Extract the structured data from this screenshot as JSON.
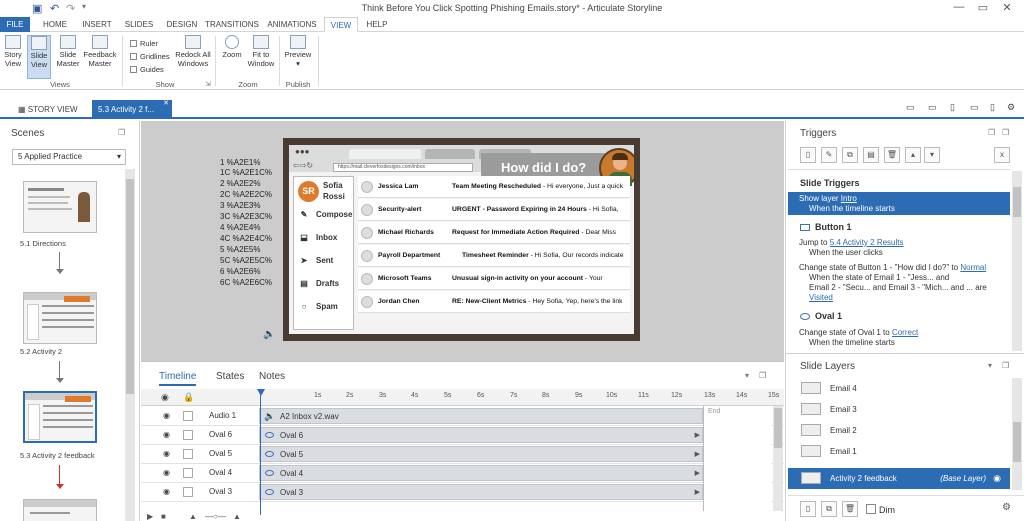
{
  "window": {
    "title": "Think Before You Click Spotting Phishing Emails.story* - Articulate Storyline",
    "minimize": "—",
    "restore": "▭",
    "close": "✕"
  },
  "menu_tabs": [
    "FILE",
    "HOME",
    "INSERT",
    "SLIDES",
    "DESIGN",
    "TRANSITIONS",
    "ANIMATIONS",
    "VIEW",
    "HELP"
  ],
  "ribbon": {
    "views": {
      "story_view": [
        "Story",
        "View"
      ],
      "slide_view": [
        "Slide",
        "View"
      ],
      "slide_master": [
        "Slide",
        "Master"
      ],
      "feedback_master": [
        "Feedback",
        "Master"
      ],
      "group": "Views"
    },
    "show": {
      "ruler": "Ruler",
      "gridlines": "Gridlines",
      "guides": "Guides",
      "redock": [
        "Redock All",
        "Windows"
      ],
      "group": "Show"
    },
    "zoom": {
      "zoom": "Zoom",
      "fit": [
        "Fit to",
        "Window"
      ],
      "group": "Zoom"
    },
    "publish": {
      "preview": "Preview",
      "group": "Publish"
    }
  },
  "doc_tabs": {
    "story": "STORY VIEW",
    "current": "5.3 Activity 2 f..."
  },
  "scenes": {
    "title": "Scenes",
    "selected_scene": "5 Applied Practice",
    "slides": [
      {
        "caption": "5.1 Directions"
      },
      {
        "caption": "5.2 Activity 2"
      },
      {
        "caption": "5.3 Activity 2 feedback"
      }
    ]
  },
  "stage": {
    "variables": [
      "1 %A2E1%",
      "1C %A2E1C%",
      "2 %A2E2%",
      "2C %A2E2C%",
      "3 %A2E3%",
      "3C %A2E3C%",
      "4 %A2E4%",
      "4C %A2E4C%",
      "5 %A2E5%",
      "5C %A2E5C%",
      "6 %A2E6%",
      "6C %A2E6C%"
    ],
    "slide": {
      "url": "https://mail.cleverfoxdesigns.com/inbox",
      "heading": "How did I do?",
      "user_initials": "SR",
      "user_first": "Sofia",
      "user_last": "Rossi",
      "nav": [
        "Compose",
        "Inbox",
        "Sent",
        "Drafts",
        "Spam"
      ],
      "emails": [
        {
          "from": "Jessica Lam",
          "subject": "Team Meeting Rescheduled",
          "preview": " - Hi everyone, Just a quick"
        },
        {
          "from": "Security-alert",
          "subject": "URGENT - Password Expiring in 24 Hours",
          "preview": " - Hi Sofia,"
        },
        {
          "from": "Michael Richards",
          "subject": "Request for Immediate Action Required",
          "preview": " - Dear Miss"
        },
        {
          "from": "Payroll Department",
          "subject": "Timesheet Reminder",
          "preview": " - Hi Sofia, Our records indicate"
        },
        {
          "from": "Microsoft Teams",
          "subject": "Unusual sign-in activity on your account",
          "preview": " - Your"
        },
        {
          "from": "Jordan Chen",
          "subject": "RE: New-Client Metrics",
          "preview": " - Hey Sofia, Yep, here's the link"
        }
      ]
    }
  },
  "timeline": {
    "tabs": [
      "Timeline",
      "States",
      "Notes"
    ],
    "ticks": [
      "1s",
      "2s",
      "3s",
      "4s",
      "5s",
      "6s",
      "7s",
      "8s",
      "9s",
      "10s",
      "11s",
      "12s",
      "13s",
      "14s",
      "15s",
      "1€"
    ],
    "end_label": "End",
    "rows": [
      {
        "name": "Audio 1",
        "bar": "A2 Inbox v2.wav",
        "kind": "audio"
      },
      {
        "name": "Oval 6",
        "bar": "Oval 6",
        "kind": "oval"
      },
      {
        "name": "Oval 5",
        "bar": "Oval 5",
        "kind": "oval"
      },
      {
        "name": "Oval 4",
        "bar": "Oval 4",
        "kind": "oval"
      },
      {
        "name": "Oval 3",
        "bar": "Oval 3",
        "kind": "oval"
      }
    ]
  },
  "triggers": {
    "title": "Triggers",
    "section": "Slide Triggers",
    "slide_trigger": {
      "pre": "Show layer ",
      "link": "Intro",
      "cond": "When the timeline starts"
    },
    "button_head": "Button 1",
    "button_jump": {
      "pre": "Jump to ",
      "link": "5.4 Activity 2 Results",
      "cond": "When the user clicks"
    },
    "button_state": {
      "line1_pre": "Change state of Button 1 - \"How did I do?\" to ",
      "line1_link": "Normal",
      "line2": "When the state of Email 1 - \"Jess... and",
      "line3": "Email 2 - \"Secu... and Email 3 - \"Mich... and ... are",
      "line4_link": "Visited"
    },
    "oval_head": "Oval 1",
    "oval_state": {
      "pre": "Change state of Oval 1 to ",
      "link": "Correct",
      "cond": "When the timeline starts"
    }
  },
  "layers": {
    "title": "Slide Layers",
    "items": [
      "Email 4",
      "Email 3",
      "Email 2",
      "Email 1"
    ],
    "base": {
      "name": "Activity 2 feedback",
      "label": "(Base Layer)"
    },
    "dim": "Dim"
  }
}
